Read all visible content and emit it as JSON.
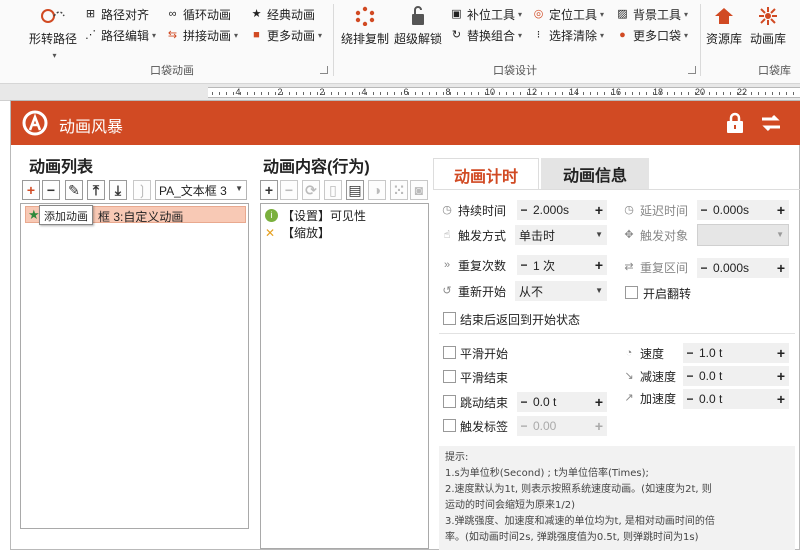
{
  "ribbon": {
    "groups": [
      {
        "name": "口袋动画"
      },
      {
        "name": "口袋设计"
      },
      {
        "name": "口袋库"
      }
    ],
    "items": {
      "shape_path": "形转路径",
      "path_align": "路径对齐",
      "path_edit": "路径编辑",
      "loop_anim": "循环动画",
      "join_anim": "拼接动画",
      "classic_anim": "经典动画",
      "more_anim": "更多动画",
      "circle_copy": "绕排复制",
      "super_unlock": "超级解锁",
      "patch_tools": "补位工具",
      "replace_combo": "替换组合",
      "locate_tools": "定位工具",
      "select_clear": "选择清除",
      "bg_tools": "背景工具",
      "more_pocket": "更多口袋",
      "resource_lib": "资源库",
      "anim_lib": "动画库"
    }
  },
  "ruler": {
    "labels": [
      "4",
      "2",
      "2",
      "4",
      "6",
      "8",
      "10",
      "12",
      "14",
      "16",
      "18",
      "20",
      "22"
    ]
  },
  "dialog": {
    "title": "动画风暴",
    "left_panel": {
      "title": "动画列表",
      "object_combo": "PA_文本框 3",
      "items": [
        {
          "label": "框 3:自定义动画"
        }
      ],
      "tooltip": "添加动画"
    },
    "middle_panel": {
      "title": "动画内容(行为)",
      "items": [
        {
          "label": "【设置】可见性"
        },
        {
          "label": "【缩放】"
        }
      ]
    },
    "right_panel": {
      "tabs": [
        {
          "label": "动画计时",
          "active": true
        },
        {
          "label": "动画信息",
          "active": false
        }
      ],
      "fields": {
        "duration_label": "持续时间",
        "duration_value": "2.000s",
        "delay_label": "延迟时间",
        "delay_value": "0.000s",
        "trigger_label": "触发方式",
        "trigger_value": "单击时",
        "trigger_obj_label": "触发对象",
        "trigger_obj_value": "",
        "repeat_label": "重复次数",
        "repeat_value": "1 次",
        "repeat_interval_label": "重复区间",
        "repeat_interval_value": "0.000s",
        "restart_label": "重新开始",
        "restart_value": "从不",
        "autoreverse_label": "开启翻转",
        "rewind_label": "结束后返回到开始状态",
        "smooth_start_label": "平滑开始",
        "smooth_end_label": "平滑结束",
        "bounce_end_label": "跳动结束",
        "bounce_end_value": "0.0 t",
        "trigger_mark_label": "触发标签",
        "trigger_mark_value": "0.00",
        "speed_label": "速度",
        "speed_value": "1.0 t",
        "decel_label": "减速度",
        "decel_value": "0.0 t",
        "accel_label": "加速度",
        "accel_value": "0.0 t"
      },
      "tips": [
        "提示:",
        "  1.s为单位秒(Second) ; t为单位倍率(Times);",
        "  2.速度默认为1t, 则表示按照系统速度动画。(如速度为2t, 则",
        "运动的时间会缩短为原来1/2)",
        "  3.弹跳强度、加速度和减速的单位均为t, 是相对动画时间的倍",
        "率。(如动画时间2s, 弹跳强度值为0.5t, 则弹跳时间为1s)"
      ]
    }
  },
  "colors": {
    "title_bar": "#d14a23",
    "active_tab_text": "#d14a23",
    "selection": "#f8c9b5"
  }
}
